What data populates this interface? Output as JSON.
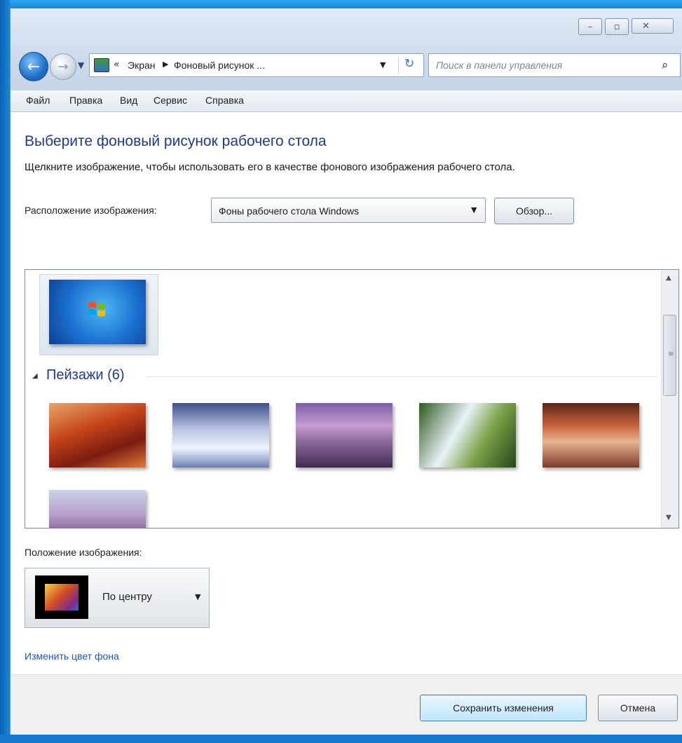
{
  "window": {
    "buttons": {
      "minimize": "–",
      "maximize": "▫",
      "close": "✕"
    }
  },
  "nav": {
    "back_icon": "←",
    "forward_icon": "→",
    "history_icon": "▼",
    "address": {
      "prefix": "«",
      "crumb1": "Экран",
      "separator": "▶",
      "crumb2": "Фоновый рисунок ...",
      "dropdown": "▼",
      "refresh_icon": "↻"
    },
    "search": {
      "placeholder": "Поиск в панели управления",
      "icon": "⌕"
    }
  },
  "menu": [
    "Файл",
    "Правка",
    "Вид",
    "Сервис",
    "Справка"
  ],
  "content": {
    "heading": "Выберите фоновый рисунок рабочего стола",
    "instruction": "Щелкните изображение, чтобы использовать его в качестве фонового изображения рабочего стола.",
    "location_label": "Расположение изображения:",
    "location_value": "Фоны рабочего стола Windows",
    "dropdown_arrow": "▼",
    "browse_label": "Обзор..."
  },
  "gallery": {
    "group_toggle": "◢",
    "group_label": "Пейзажи (6)",
    "scroll_up": "▲",
    "scroll_down": "▼",
    "scroll_grip": "≡",
    "colors": {
      "selected_frame": "#dde6ef",
      "group_text": "#1e3a8a"
    }
  },
  "position": {
    "label": "Положение изображения:",
    "value": "По центру",
    "arrow": "▼"
  },
  "links": {
    "change_color": "Изменить цвет фона"
  },
  "footer": {
    "save_label": "Сохранить изменения",
    "cancel_label": "Отмена"
  }
}
